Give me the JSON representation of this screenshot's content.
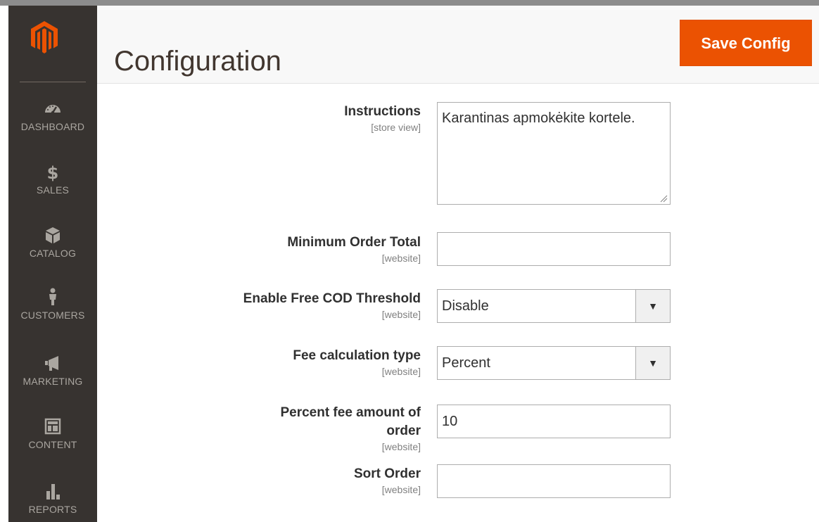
{
  "header": {
    "title": "Configuration",
    "save_label": "Save Config"
  },
  "sidebar": {
    "logo_icon": "magento-logo-icon",
    "items": [
      {
        "label": "DASHBOARD",
        "icon": "dashboard-gauge-icon"
      },
      {
        "label": "SALES",
        "icon": "dollar-icon"
      },
      {
        "label": "CATALOG",
        "icon": "box-icon"
      },
      {
        "label": "CUSTOMERS",
        "icon": "person-icon"
      },
      {
        "label": "MARKETING",
        "icon": "megaphone-icon"
      },
      {
        "label": "CONTENT",
        "icon": "layout-icon"
      },
      {
        "label": "REPORTS",
        "icon": "bar-chart-icon"
      }
    ]
  },
  "form": {
    "instructions": {
      "label": "Instructions",
      "scope": "[store view]",
      "value": "Karantinas apmokėkite kortele."
    },
    "min_order_total": {
      "label": "Minimum Order Total",
      "scope": "[website]",
      "value": ""
    },
    "free_cod_threshold": {
      "label": "Enable Free COD Threshold",
      "scope": "[website]",
      "value": "Disable"
    },
    "fee_calc_type": {
      "label": "Fee calculation type",
      "scope": "[website]",
      "value": "Percent"
    },
    "percent_fee": {
      "label_line1": "Percent fee amount of",
      "label_line2": "order",
      "scope": "[website]",
      "value": "10"
    },
    "sort_order": {
      "label": "Sort Order",
      "scope": "[website]",
      "value": ""
    }
  },
  "colors": {
    "sidebar_bg": "#373330",
    "accent": "#eb5202",
    "header_bg": "#f8f8f8"
  }
}
